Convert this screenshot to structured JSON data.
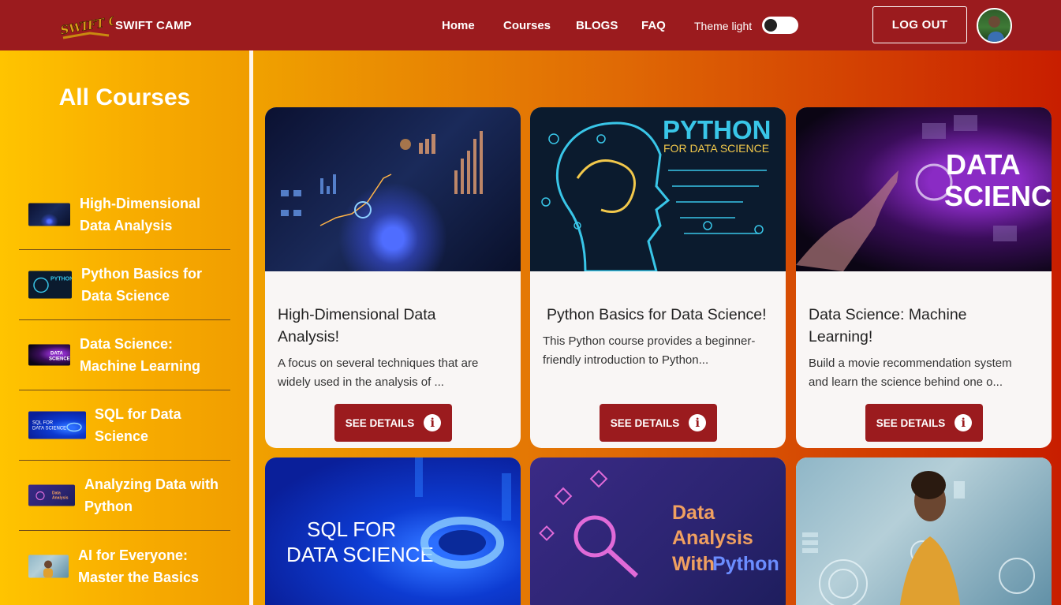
{
  "header": {
    "brand": "SWIFT CAMP",
    "logo_text": "SWIFT CAMP",
    "nav": [
      "Home",
      "Courses",
      "BLOGS",
      "FAQ"
    ],
    "theme_label": "Theme light",
    "logout_label": "LOG OUT",
    "icons": {
      "theme_toggle": "toggle-switch",
      "avatar": "user-avatar"
    }
  },
  "sidebar": {
    "title": "All Courses",
    "items": [
      {
        "label_line1": "High-Dimensional",
        "label_line2": "Data Analysis"
      },
      {
        "label_line1": "Python Basics for",
        "label_line2": "Data Science"
      },
      {
        "label_line1": "Data Science:",
        "label_line2": "Machine Learning"
      },
      {
        "label_line1": "SQL for Data",
        "label_line2": "Science"
      },
      {
        "label_line1": "Analyzing Data with",
        "label_line2": "Python"
      },
      {
        "label_line1": "AI for Everyone:",
        "label_line2": "Master the Basics"
      }
    ]
  },
  "cards": [
    {
      "title_line1": "High-Dimensional Data",
      "title_line2": "Analysis!",
      "desc_line1": "A focus on several techniques that are",
      "desc_line2": "widely used in the analysis of ...",
      "button": "SEE DETAILS"
    },
    {
      "title_line1": "Python Basics for Data Science!",
      "desc_line1": "This Python course provides a beginner-",
      "desc_line2": "friendly introduction to Python...",
      "button": "SEE DETAILS",
      "image_text1": "PYTHON",
      "image_text2": "FOR DATA SCIENCE"
    },
    {
      "title_line1": "Data Science: Machine",
      "title_line2": "Learning!",
      "desc_line1": "Build a movie recommendation system",
      "desc_line2": "and learn the science behind one o...",
      "button": "SEE DETAILS",
      "image_text1": "DATA",
      "image_text2": "SCIENCE"
    },
    {
      "image_text1": "SQL FOR",
      "image_text2": "DATA SCIENCE"
    },
    {
      "image_text1": "Data",
      "image_text2": "Analysis",
      "image_text3": "With",
      "image_text4": "Python"
    },
    {}
  ],
  "colors": {
    "header_bg": "#9b1b1e",
    "button_bg": "#9b1b1e",
    "sidebar_bg": "#ffc400",
    "card_bg": "#f9f6f5"
  }
}
